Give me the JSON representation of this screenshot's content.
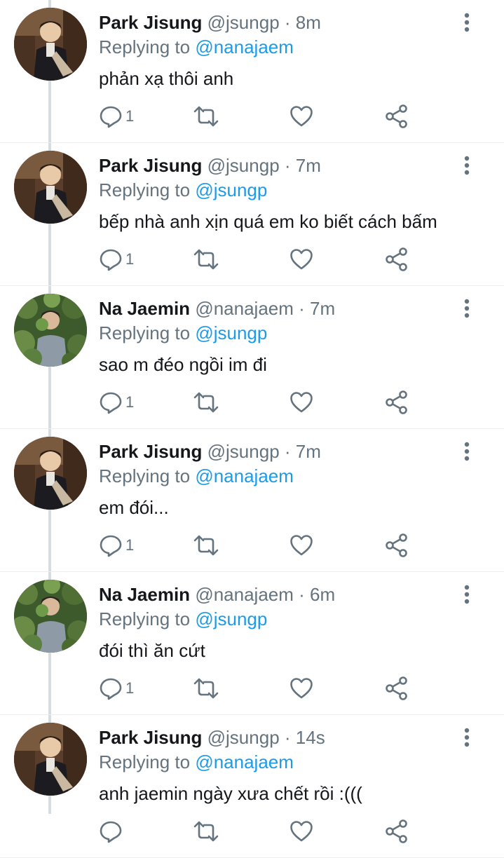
{
  "colors": {
    "name": "#15171a",
    "meta": "#65737e",
    "mention": "#1c9be9",
    "thread_line": "#d7dce0"
  },
  "icons": {
    "reply": "reply-icon",
    "retweet": "retweet-icon",
    "like": "heart-icon",
    "share": "share-icon",
    "more": "more-vertical-icon"
  },
  "tweets": [
    {
      "name": "Park Jisung",
      "handle": "@jsungp",
      "time": "· 8m",
      "replying_label": "Replying to",
      "replying_to": "@nanajaem",
      "text": "phản xạ thôi anh",
      "reply_count": "1",
      "avatar": "park-jisung-avatar"
    },
    {
      "name": "Park Jisung",
      "handle": "@jsungp",
      "time": "· 7m",
      "replying_label": "Replying to",
      "replying_to": "@jsungp",
      "text": "bếp nhà anh xịn quá em ko biết cách bấm",
      "reply_count": "1",
      "avatar": "park-jisung-avatar"
    },
    {
      "name": "Na Jaemin",
      "handle": "@nanajaem",
      "time": "· 7m",
      "replying_label": "Replying to",
      "replying_to": "@jsungp",
      "text": "sao m đéo ngồi im đi",
      "reply_count": "1",
      "avatar": "na-jaemin-avatar"
    },
    {
      "name": "Park Jisung",
      "handle": "@jsungp",
      "time": "· 7m",
      "replying_label": "Replying to",
      "replying_to": "@nanajaem",
      "text": "em đói...",
      "reply_count": "1",
      "avatar": "park-jisung-avatar"
    },
    {
      "name": "Na Jaemin",
      "handle": "@nanajaem",
      "time": "· 6m",
      "replying_label": "Replying to",
      "replying_to": "@jsungp",
      "text": "đói thì ăn cứt",
      "reply_count": "1",
      "avatar": "na-jaemin-avatar"
    },
    {
      "name": "Park Jisung",
      "handle": "@jsungp",
      "time": "· 14s",
      "replying_label": "Replying to",
      "replying_to": "@nanajaem",
      "text": "anh jaemin ngày xưa chết rồi :(((",
      "reply_count": "",
      "avatar": "park-jisung-avatar"
    }
  ]
}
